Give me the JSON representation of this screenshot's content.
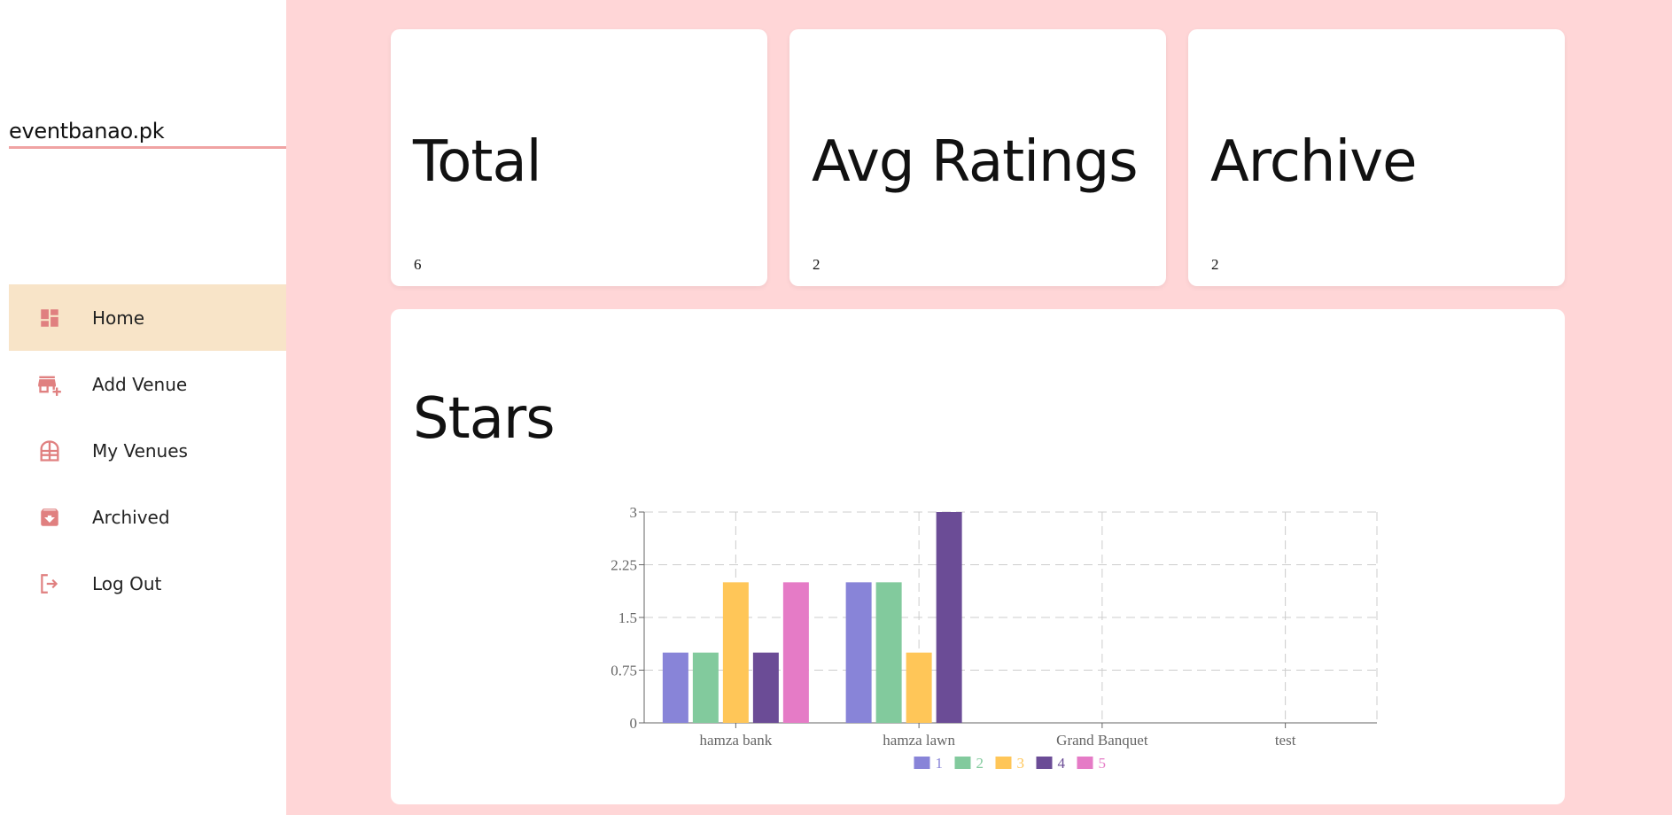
{
  "sidebar": {
    "brand": "eventbanao.pk",
    "items": [
      {
        "label": "Home",
        "icon": "dashboard-icon",
        "active": true
      },
      {
        "label": "Add Venue",
        "icon": "add-business-icon",
        "active": false
      },
      {
        "label": "My Venues",
        "icon": "venue-icon",
        "active": false
      },
      {
        "label": "Archived",
        "icon": "archive-icon",
        "active": false
      },
      {
        "label": "Log Out",
        "icon": "logout-icon",
        "active": false
      }
    ]
  },
  "cards": [
    {
      "title": "Total",
      "value": "6"
    },
    {
      "title": "Avg Ratings",
      "value": "2"
    },
    {
      "title": "Archive",
      "value": "2"
    }
  ],
  "stars": {
    "title": "Stars"
  },
  "colors": {
    "background": "#ffd6d7",
    "active_nav": "#f8e4c8",
    "icon": "#e08080"
  },
  "chart_data": {
    "type": "bar",
    "categories": [
      "hamza bank",
      "hamza lawn",
      "Grand Banquet",
      "test"
    ],
    "ylim": [
      0,
      3
    ],
    "yticks": [
      "0",
      "0.75",
      "1.5",
      "2.25",
      "3"
    ],
    "grid": true,
    "legend": "bottom",
    "series": [
      {
        "name": "1",
        "color": "#8884d8",
        "values": [
          1,
          2,
          0,
          0
        ]
      },
      {
        "name": "2",
        "color": "#82ca9d",
        "values": [
          1,
          2,
          0,
          0
        ]
      },
      {
        "name": "3",
        "color": "#ffc658",
        "values": [
          2,
          1,
          0,
          0
        ]
      },
      {
        "name": "4",
        "color": "#6b4c96",
        "values": [
          1,
          3,
          0,
          0
        ]
      },
      {
        "name": "5",
        "color": "#e57bc6",
        "values": [
          2,
          0,
          0,
          0
        ]
      }
    ]
  }
}
